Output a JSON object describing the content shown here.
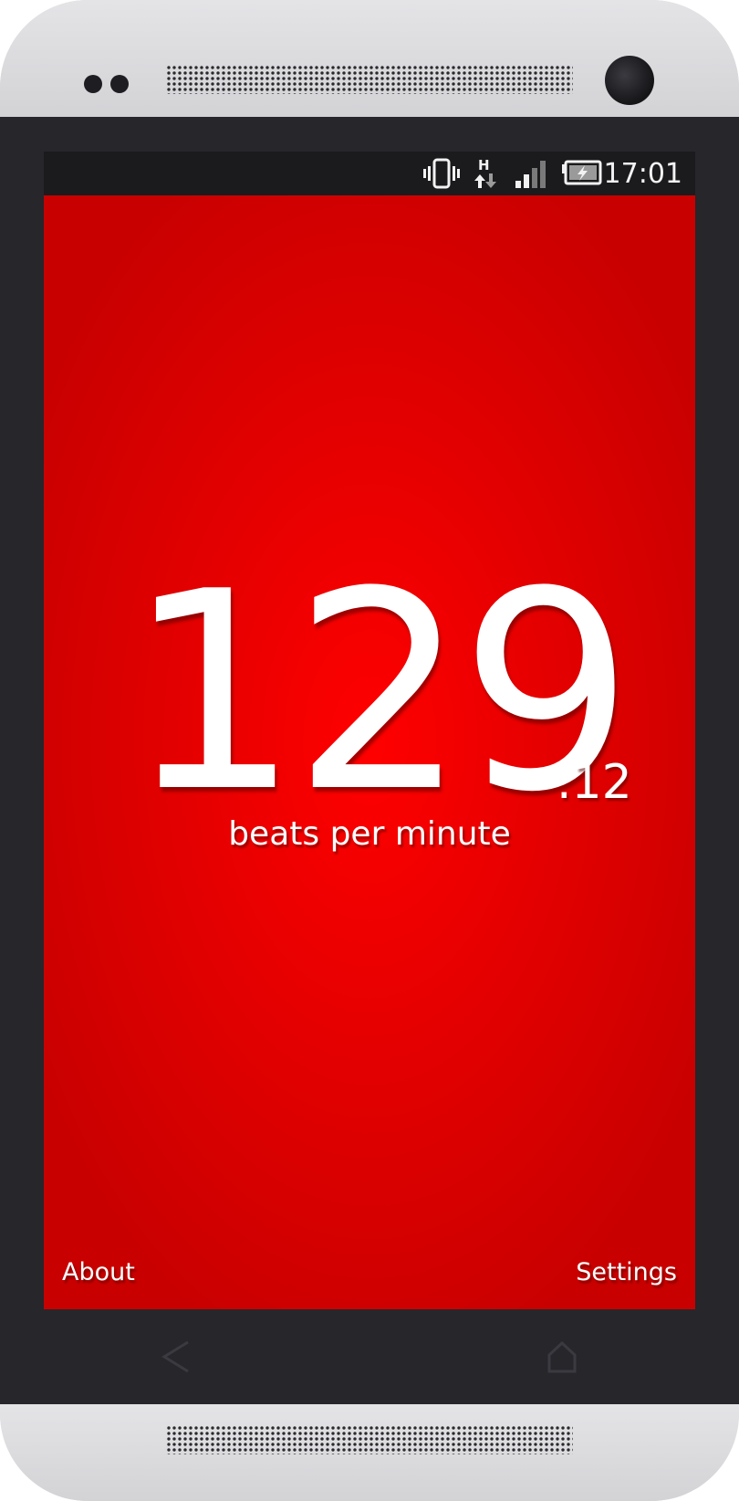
{
  "status_bar": {
    "time": "17:01",
    "network_type": "H",
    "icons": [
      "vibrate-icon",
      "network-data-icon",
      "signal-icon",
      "battery-charging-icon"
    ]
  },
  "heart_rate": {
    "value_integer": "129",
    "value_fraction": ".12",
    "unit_label": "beats per minute"
  },
  "footer": {
    "about_label": "About",
    "settings_label": "Settings"
  },
  "nav_bar": {
    "icons": [
      "back-icon",
      "home-icon"
    ]
  },
  "colors": {
    "app_background": "#e60000",
    "app_center": "#ff0000",
    "text": "#ffffff",
    "statusbar": "#1b1b1e"
  }
}
